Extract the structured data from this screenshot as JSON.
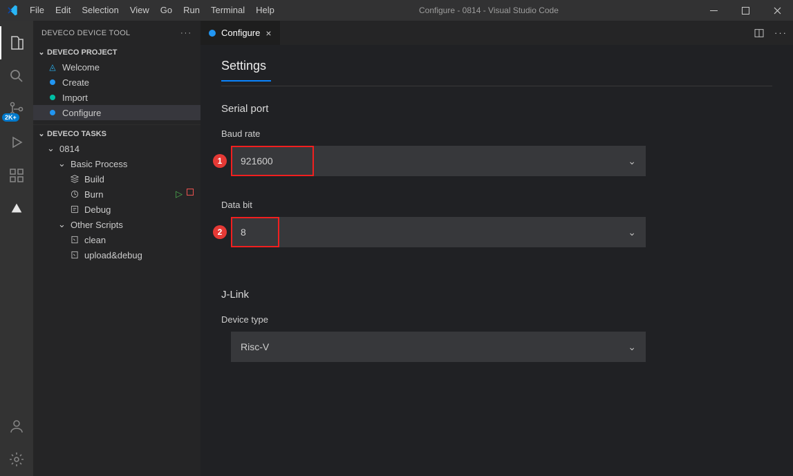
{
  "window": {
    "title": "Configure - 0814 - Visual Studio Code"
  },
  "menu": [
    "File",
    "Edit",
    "Selection",
    "View",
    "Go",
    "Run",
    "Terminal",
    "Help"
  ],
  "activity": {
    "badge": "2K+"
  },
  "sidebar": {
    "title": "DEVECO DEVICE TOOL",
    "sections": {
      "project": {
        "title": "DEVECO PROJECT",
        "items": [
          {
            "label": "Welcome"
          },
          {
            "label": "Create"
          },
          {
            "label": "Import"
          },
          {
            "label": "Configure",
            "selected": true
          }
        ]
      },
      "tasks": {
        "title": "DEVECO TASKS",
        "root": "0814",
        "groups": [
          {
            "label": "Basic Process",
            "items": [
              {
                "label": "Build"
              },
              {
                "label": "Burn",
                "actions": true
              },
              {
                "label": "Debug"
              }
            ]
          },
          {
            "label": "Other Scripts",
            "items": [
              {
                "label": "clean"
              },
              {
                "label": "upload&debug"
              }
            ]
          }
        ]
      }
    }
  },
  "tab": {
    "label": "Configure"
  },
  "settings": {
    "heading": "Settings",
    "serial": {
      "section": "Serial port",
      "baud": {
        "label": "Baud rate",
        "value": "921600",
        "badge": "1"
      },
      "databit": {
        "label": "Data bit",
        "value": "8",
        "badge": "2"
      }
    },
    "jlink": {
      "section": "J-Link",
      "devicetype": {
        "label": "Device type",
        "value": "Risc-V"
      }
    }
  }
}
